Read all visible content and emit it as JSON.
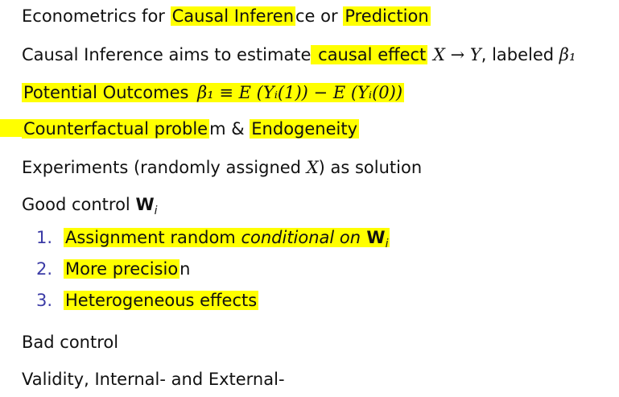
{
  "lines": {
    "l1_pre": "Econometrics for ",
    "l1_hl1": "Causal Inferen",
    "l1_mid": "ce or ",
    "l1_hl2": "Prediction",
    "l2_pre": "Causal Inference aims to estimate",
    "l2_hl": " causal effect",
    "l2_math": " X → Y",
    "l2_post": ", labeled ",
    "l2_beta": "β₁",
    "l3_hl": "Potential Outcomes",
    "l3_math": " β₁ ≡ E (Yᵢ(1)) − E (Yᵢ(0))",
    "l4_hl": "Counterfactual proble",
    "l4_mid": "m & ",
    "l4_hl2": "Endogeneity",
    "l5_pre": "Experiments (randomly assigned ",
    "l5_math": "X",
    "l5_post": ") as solution",
    "l6_pre": "Good control ",
    "l6_bold": "W",
    "l6_sub": "i",
    "i1_num": "1.",
    "i1_pre": "Assignment random ",
    "i1_it": "conditional on",
    "i1_bold": " W",
    "i1_sub": "i",
    "i2_num": "2.",
    "i2_text": "More precisio",
    "i2_tail": "n",
    "i3_num": "3.",
    "i3_text": "Heterogeneous effects",
    "l7": "Bad control",
    "l8": "Validity, Internal- and External-"
  },
  "colors": {
    "highlight": "#ffff00",
    "enum_number": "#3b3ba6"
  }
}
